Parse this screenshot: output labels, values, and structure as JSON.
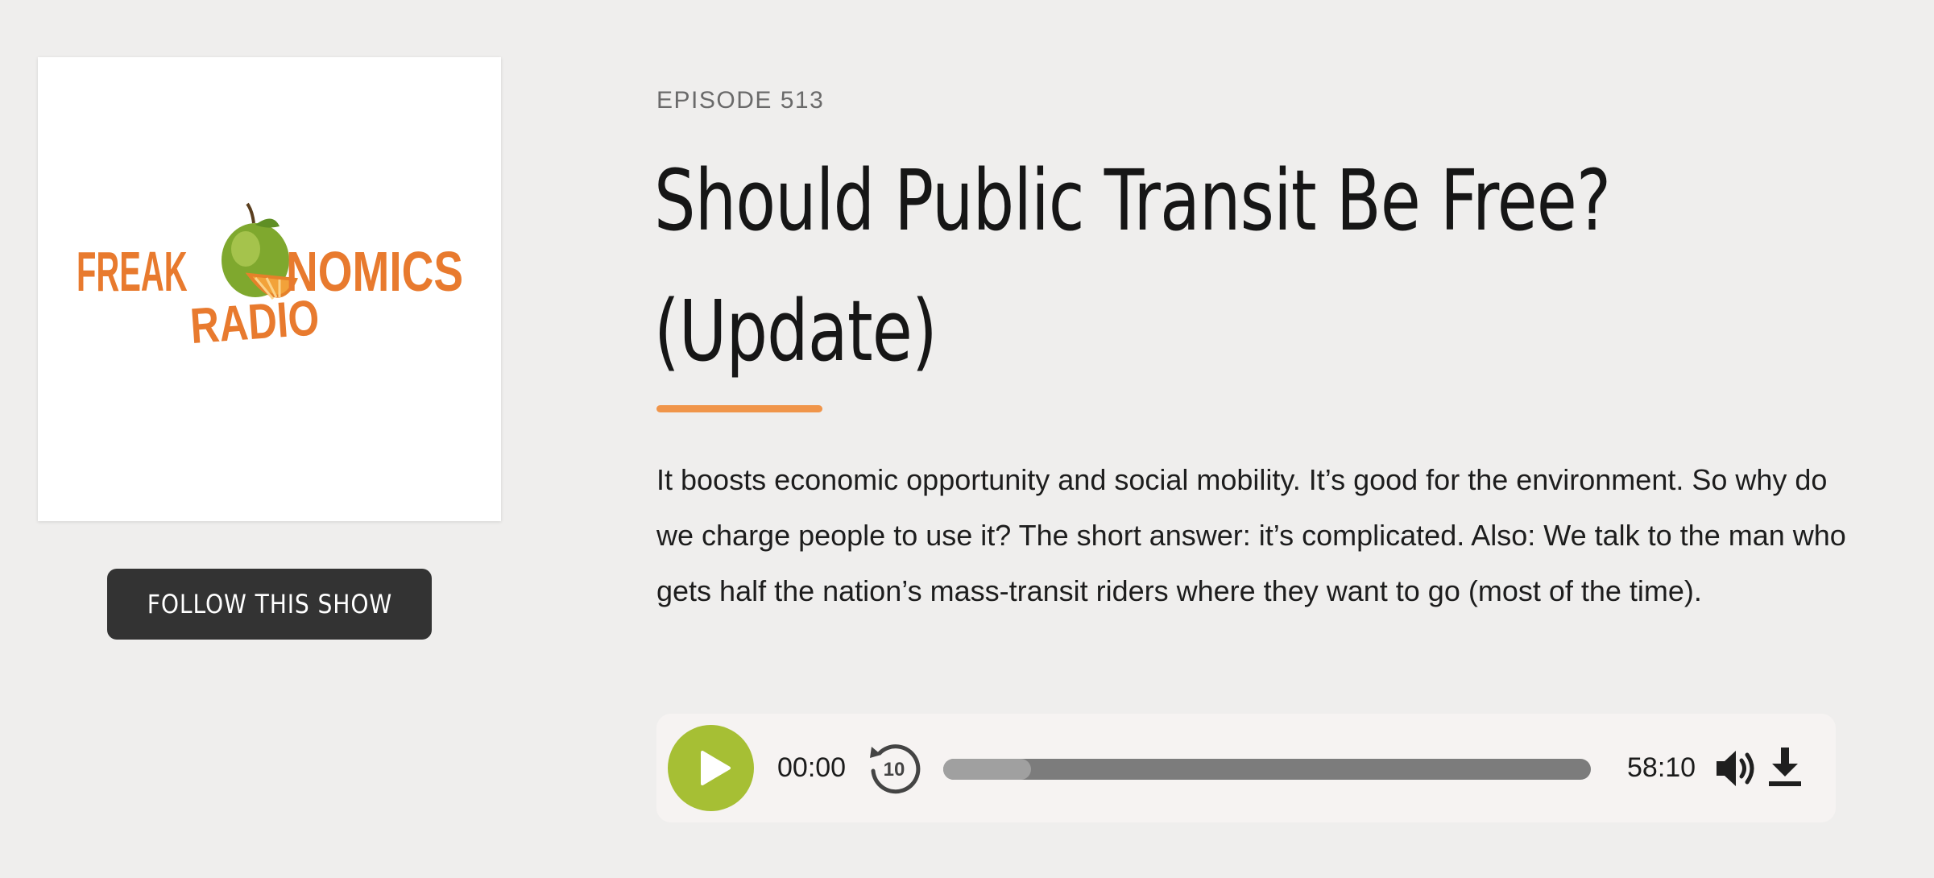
{
  "show": {
    "logo_text_line1_left": "FREAK",
    "logo_text_line1_right": "NOMICS",
    "logo_text_line2": "RADIO",
    "follow_label": "FOLLOW THIS SHOW"
  },
  "episode": {
    "number_label": "EPISODE 513",
    "title_line1": "Should Public Transit Be Free?",
    "title_line2": "(Update)",
    "description": "It boosts economic opportunity and social mobility. It’s good for the environment. So why do we charge people to use it? The short answer: it’s complicated. Also: We talk to the man who gets half the nation’s mass-transit riders where they want to go (most of the time)."
  },
  "player": {
    "current_time": "00:00",
    "total_time": "58:10",
    "rewind_seconds": "10",
    "progress_fraction": 0,
    "buffered_fraction": 0.135,
    "icons": {
      "play": "play-icon",
      "rewind": "rewind-10-icon",
      "volume": "volume-icon",
      "download": "download-icon"
    }
  },
  "colors": {
    "background": "#efeeed",
    "accent_orange": "#f0954a",
    "play_green": "#a6bf34",
    "button_dark": "#333333",
    "logo_orange": "#e87a2e"
  }
}
